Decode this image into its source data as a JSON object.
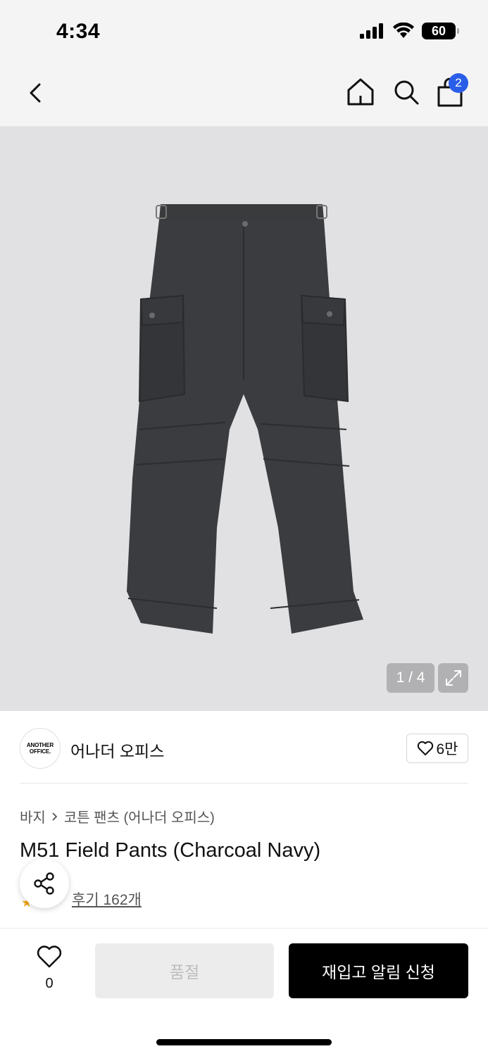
{
  "status_bar": {
    "time": "4:34",
    "battery": "60",
    "icons": [
      "cellular-signal-icon",
      "wifi-icon",
      "battery-icon"
    ]
  },
  "nav": {
    "icons": [
      "back-chevron-icon",
      "home-icon",
      "search-icon",
      "shopping-bag-icon"
    ],
    "cart_count": "2"
  },
  "gallery": {
    "counter": "1 / 4",
    "icon": "expand-icon"
  },
  "brand": {
    "logo_line1": "ANOTHER",
    "logo_line2": "OFFICE.",
    "name": "어나더 오피스",
    "likes": "6만"
  },
  "product": {
    "breadcrumb": [
      "바지",
      "코튼 팬츠 (어나더 오피스)"
    ],
    "title": "M51 Field Pants (Charcoal Navy)",
    "reviews": "후기 162개"
  },
  "bottom_bar": {
    "wish_count": "0",
    "soldout_label": "품절",
    "restock_label": "재입고 알림 신청"
  },
  "colors": {
    "accent_badge": "#2b5ee8",
    "primary_button": "#000000",
    "disabled_button": "#ececec",
    "image_background": "#e1e1e3"
  }
}
